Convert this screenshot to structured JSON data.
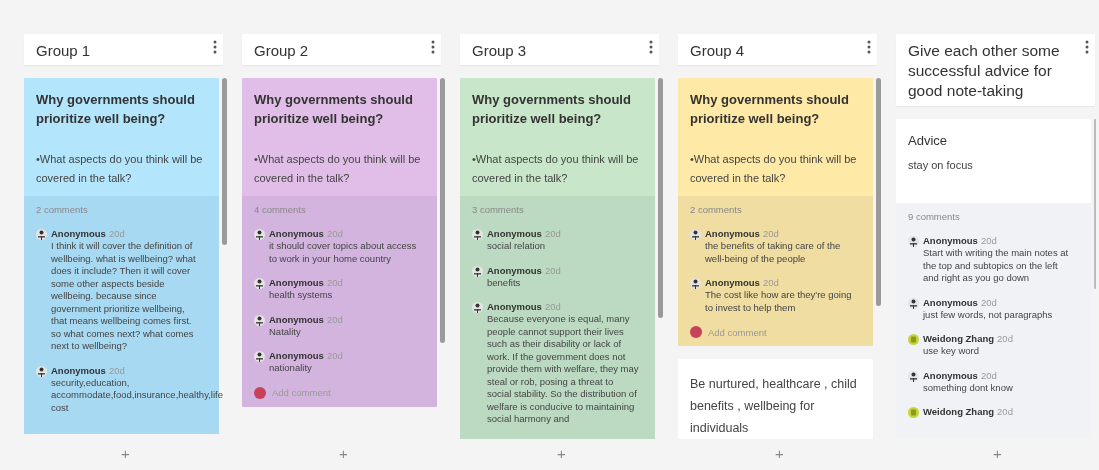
{
  "columns": [
    {
      "title": "Group 1",
      "cards": [
        {
          "kind": "question",
          "color": "#b3e5fc",
          "title": "Why governments should prioritize well being?",
          "body": "•What aspects do you think will be covered in the talk?",
          "comment_count": "2 comments",
          "comments": [
            {
              "kind": "anonymous",
              "author": "Anonymous",
              "time": "20d",
              "text": "I think it will cover the definition of wellbeing. what is wellbeing? what does it include? Then it will cover some other aspects beside wellbeing. because since government prioritize wellbeing, that means wellbeing comes first. so what comes next? what comes next to wellbeing?"
            },
            {
              "kind": "anonymous",
              "author": "Anonymous",
              "time": "20d",
              "text": "security,education, accommodate,food,insurance,healthy,life cost"
            }
          ]
        }
      ]
    },
    {
      "title": "Group 2",
      "cards": [
        {
          "kind": "question",
          "color": "#e1bee7",
          "title": "Why governments should prioritize well being?",
          "body": "•What aspects do you think will be covered in the talk?",
          "comment_count": "4 comments",
          "comments": [
            {
              "kind": "anonymous",
              "author": "Anonymous",
              "time": "20d",
              "text": "it should cover topics about access to work in your home country"
            },
            {
              "kind": "anonymous",
              "author": "Anonymous",
              "time": "20d",
              "text": "health systems"
            },
            {
              "kind": "anonymous",
              "author": "Anonymous",
              "time": "20d",
              "text": "Natality"
            },
            {
              "kind": "anonymous",
              "author": "Anonymous",
              "time": "20d",
              "text": "nationality"
            }
          ],
          "add_comment": {
            "placeholder": "Add comment"
          }
        }
      ]
    },
    {
      "title": "Group 3",
      "cards": [
        {
          "kind": "question",
          "color": "#c8e6c9",
          "title": "Why governments should prioritize well being?",
          "body": "•What aspects do you think will be covered in the talk?",
          "comment_count": "3 comments",
          "comments": [
            {
              "kind": "anonymous",
              "author": "Anonymous",
              "time": "20d",
              "text": "social relation"
            },
            {
              "kind": "anonymous",
              "author": "Anonymous",
              "time": "20d",
              "text": "benefits"
            },
            {
              "kind": "anonymous",
              "author": "Anonymous",
              "time": "20d",
              "text": "Because everyone is equal, many people cannot support their lives such as their disability or lack of work. If the government does not provide them with welfare, they may steal or rob, posing a threat to social stability. So the distribution of welfare is conducive to maintaining social harmony and"
            }
          ]
        }
      ]
    },
    {
      "title": "Group 4",
      "cards": [
        {
          "kind": "question",
          "color": "#ffe9a6",
          "title": "Why governments should prioritize well being?",
          "body": "•What aspects do you think will be covered in the talk?",
          "comment_count": "2 comments",
          "comments": [
            {
              "kind": "anonymous",
              "author": "Anonymous",
              "time": "20d",
              "text": "the benefits of taking care of the well-being of the people"
            },
            {
              "kind": "anonymous",
              "author": "Anonymous",
              "time": "20d",
              "text": "The cost like how are they're going to invest to help them"
            }
          ],
          "add_comment": {
            "placeholder": "Add comment"
          }
        },
        {
          "kind": "note",
          "color": "#ffffff",
          "body": "Be nurtured, healthcare , child benefits , wellbeing for individuals"
        }
      ]
    },
    {
      "title": "Give each other some successful advice for good note-taking",
      "cards": [
        {
          "kind": "question",
          "color": "#ffffff",
          "title": "Advice",
          "body": "stay on focus",
          "comment_count": "9 comments",
          "comments": [
            {
              "kind": "anonymous",
              "author": "Anonymous",
              "time": "20d",
              "text": "Start with writing the main notes at the top and subtopics on the left and right as you go down"
            },
            {
              "kind": "anonymous",
              "author": "Anonymous",
              "time": "20d",
              "text": "just few words, not paragraphs"
            },
            {
              "kind": "user",
              "author": "Weidong Zhang",
              "time": "20d",
              "text": "use key word"
            },
            {
              "kind": "anonymous",
              "author": "Anonymous",
              "time": "20d",
              "text": "something dont know"
            },
            {
              "kind": "user",
              "author": "Weidong Zhang",
              "time": "20d"
            }
          ]
        }
      ]
    }
  ],
  "add_button": "+"
}
